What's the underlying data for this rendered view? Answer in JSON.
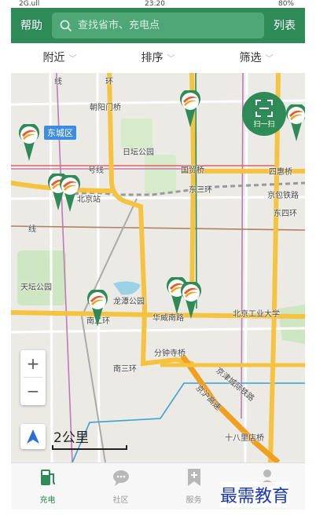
{
  "status_bar": {
    "signal": "2G.ull",
    "time": "23:20",
    "battery": "80%"
  },
  "header": {
    "help_label": "帮助",
    "search_placeholder": "查找省市、充电点",
    "list_label": "列表"
  },
  "filters": [
    {
      "label": "附近"
    },
    {
      "label": "排序"
    },
    {
      "label": "筛选"
    }
  ],
  "map": {
    "district_badge": "东城区",
    "scan_label": "扫一扫",
    "scale_label": "2公里",
    "zoom_in": "+",
    "zoom_out": "−",
    "labels": [
      "环",
      "线",
      "朝阳门桥",
      "日坛公园",
      "北京站",
      "国贸桥",
      "四惠桥",
      "京包铁路",
      "东三环",
      "东四环",
      "天坛公园",
      "龙潭公园",
      "南二环",
      "华威南路",
      "北京工业大学",
      "分钟寺桥",
      "南三环",
      "十八里店桥",
      "号线",
      "京津城际铁路",
      "京沪高速",
      "线"
    ]
  },
  "tabs": [
    {
      "label": "充电"
    },
    {
      "label": "社区"
    },
    {
      "label": "服务"
    },
    {
      "label": "我的"
    }
  ],
  "watermark": "最需教育",
  "colors": {
    "brand": "#2e8b57",
    "road_major": "#f6c341",
    "road_express": "#f0a020",
    "water": "#9cd2e8",
    "park": "#cfe6c2"
  }
}
